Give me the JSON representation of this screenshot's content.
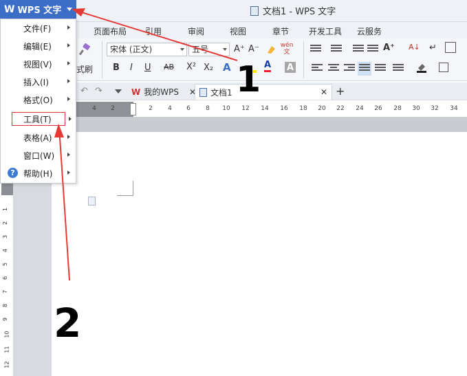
{
  "app_button": {
    "label": "WPS 文字",
    "logo": "W"
  },
  "window": {
    "title": "文档1 - WPS 文字"
  },
  "ribbon_tabs": [
    "页面布局",
    "引用",
    "审阅",
    "视图",
    "章节",
    "开发工具",
    "云服务"
  ],
  "ribbon": {
    "font_name": "宋体 (正文)",
    "font_size": "五号",
    "format_painter_label": "式刷",
    "bold": "B",
    "italic": "I",
    "underline": "U",
    "strike": "AB",
    "superscript": "X²",
    "subscript": "X₂",
    "grow": "A⁺",
    "shrink": "A⁻",
    "font_color": "A",
    "char_shade": "A",
    "pinyin": "wén 文"
  },
  "tabs_bar": {
    "my_wps": "我的WPS",
    "doc_tab": "文档1",
    "add_tab": "+"
  },
  "h_ruler_ticks": [
    "4",
    "2",
    "",
    "2",
    "4",
    "6",
    "8",
    "10",
    "12",
    "14",
    "16",
    "18",
    "20",
    "22",
    "24",
    "26",
    "28",
    "30",
    "32",
    "34"
  ],
  "v_ruler_ticks": [
    "1",
    "2",
    "3",
    "4",
    "5",
    "6",
    "7",
    "8",
    "9",
    "10",
    "11",
    "12"
  ],
  "menu": {
    "items": [
      {
        "label": "文件(F)"
      },
      {
        "label": "编辑(E)"
      },
      {
        "label": "视图(V)"
      },
      {
        "label": "插入(I)"
      },
      {
        "label": "格式(O)"
      },
      {
        "label": "工具(T)"
      },
      {
        "label": "表格(A)"
      },
      {
        "label": "窗口(W)"
      },
      {
        "label": "帮助(H)"
      }
    ]
  },
  "annotations": {
    "one": "1",
    "two": "2"
  },
  "colors": {
    "accent": "#3d6ec7",
    "arrow": "#e53935",
    "ink": "#000000"
  }
}
